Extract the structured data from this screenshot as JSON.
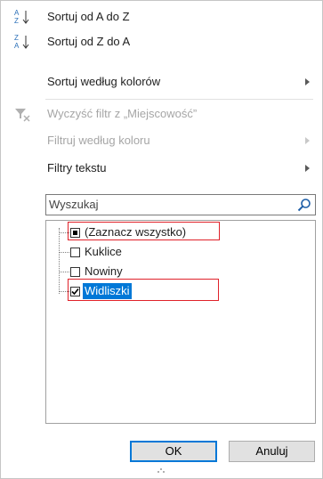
{
  "menu": {
    "sort_asc": "Sortuj od A do Z",
    "sort_desc": "Sortuj od Z do A",
    "sort_by_color": "Sortuj według kolorów",
    "clear_filter": "Wyczyść filtr z „Miejscowość”",
    "filter_by_color": "Filtruj według koloru",
    "text_filters": "Filtry tekstu"
  },
  "search": {
    "placeholder": "Wyszukaj"
  },
  "list": {
    "items": [
      {
        "label": "(Zaznacz wszystko)",
        "state": "indeterminate"
      },
      {
        "label": "Kuklice",
        "state": "unchecked"
      },
      {
        "label": "Nowiny",
        "state": "unchecked"
      },
      {
        "label": "Widliszki",
        "state": "checked"
      }
    ]
  },
  "buttons": {
    "ok": "OK",
    "cancel": "Anuluj"
  },
  "colors": {
    "accent": "#0078d7",
    "highlight": "#e0222a",
    "sort_a": "#2a6fb8",
    "sort_z": "#2a6fb8"
  }
}
